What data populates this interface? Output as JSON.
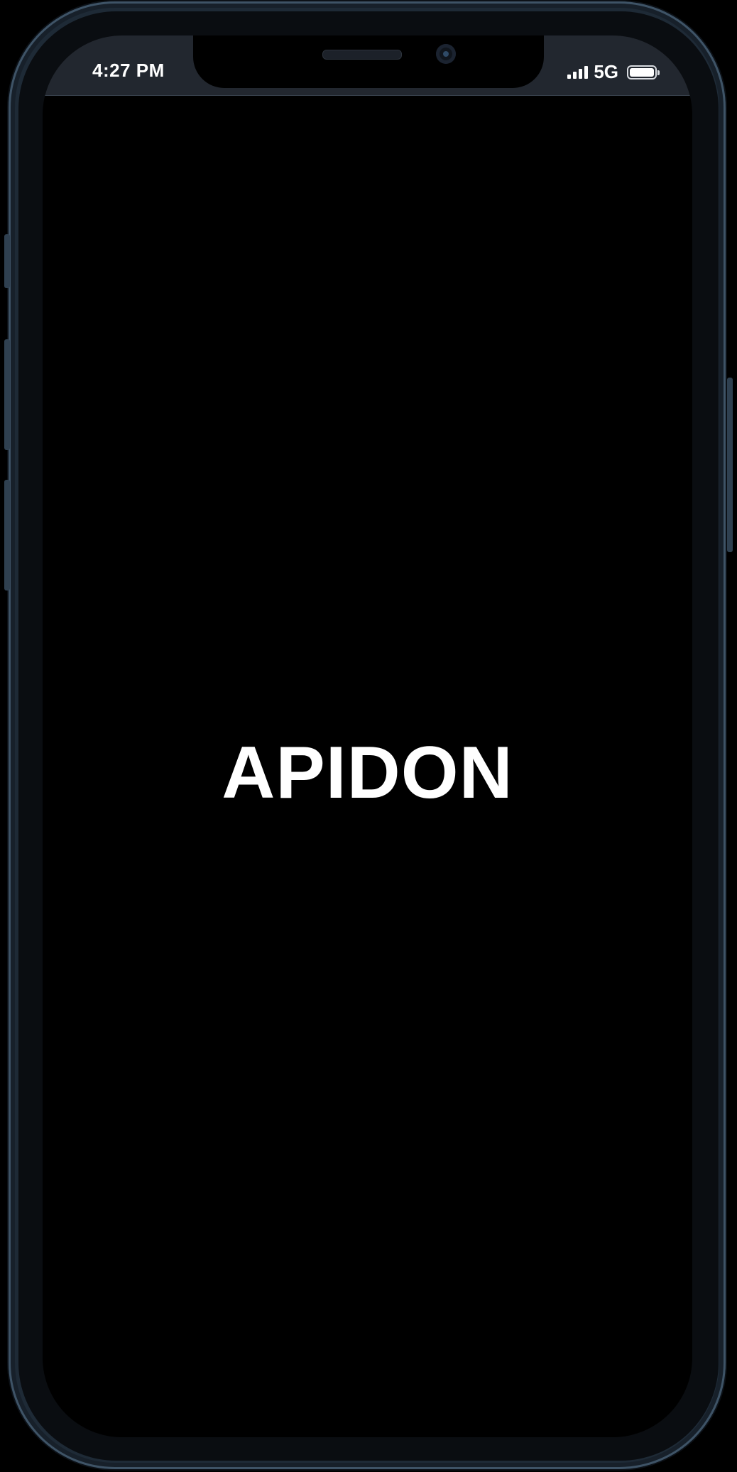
{
  "status_bar": {
    "time": "4:27 PM",
    "network": "5G",
    "icons": [
      "signal-bars-icon",
      "battery-icon"
    ]
  },
  "splash": {
    "title": "APIDON"
  },
  "colors": {
    "background": "#000000",
    "status_bar": "#22272f",
    "frame": "#1e2a36",
    "text": "#ffffff"
  }
}
